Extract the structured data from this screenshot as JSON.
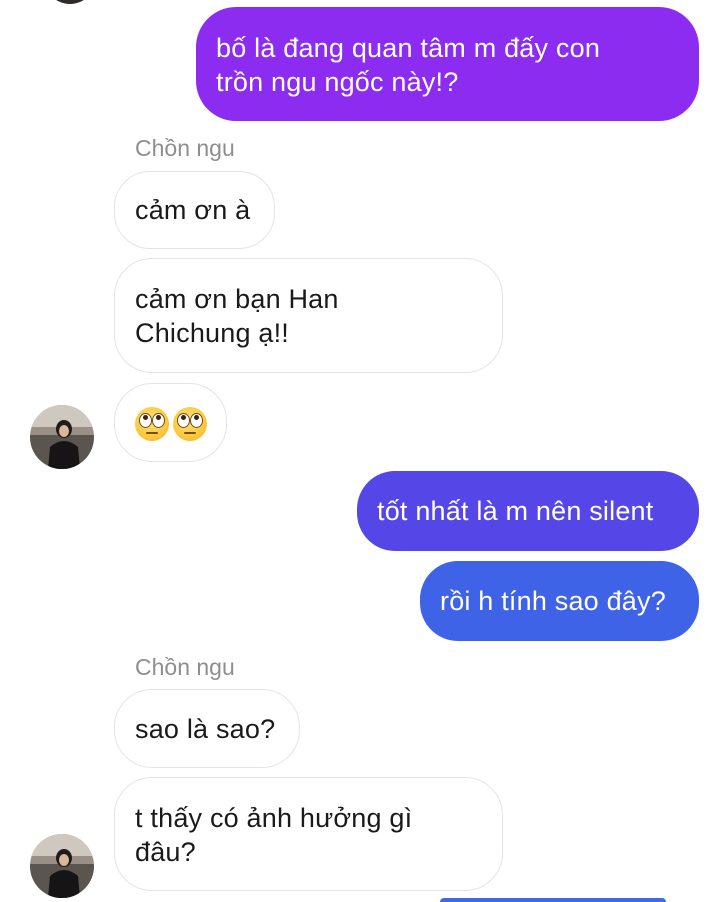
{
  "conversation": {
    "sender_name": "Chồn ngu",
    "messages": [
      {
        "direction": "outgoing",
        "text": "bố là đang quan tâm m đấy con\ntrồn ngu ngốc này!?"
      },
      {
        "direction": "incoming",
        "text": "cảm ơn à"
      },
      {
        "direction": "incoming",
        "text": "cảm ơn bạn Han\nChichung ạ!!"
      },
      {
        "direction": "incoming",
        "emoji": "face-with-rolling-eyes x2"
      },
      {
        "direction": "outgoing",
        "text": "tốt nhất là m nên silent"
      },
      {
        "direction": "outgoing",
        "text": "rồi h tính sao đây?"
      },
      {
        "direction": "incoming",
        "text": "sao là sao?"
      },
      {
        "direction": "incoming",
        "text": "t thấy có ảnh hưởng gì\nđâu?"
      }
    ]
  },
  "colors": {
    "outgoing_purple": "#8a2be8",
    "outgoing_indigo": "#5b4be6",
    "outgoing_blue": "#3f63e4",
    "incoming_bg": "#ffffff",
    "incoming_border": "#e4e4e4",
    "sender_name": "#8e8e8e"
  }
}
